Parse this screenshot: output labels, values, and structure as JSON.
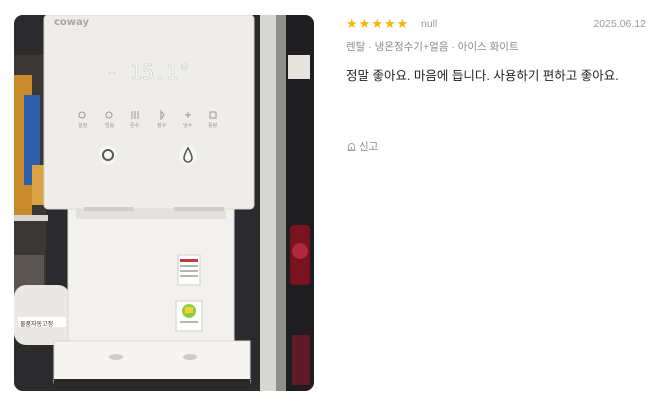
{
  "review": {
    "rating": 5,
    "stars": [
      "★",
      "★",
      "★",
      "★",
      "★"
    ],
    "author": "null",
    "date": "2025.06.12",
    "option": "렌탈 · 냉온정수기+얼음 · 아이스 화이트",
    "text": "정말 좋아요. 마음에 듭니다. 사용하기 편하고 좋아요.",
    "report_label": "신고",
    "report_icon": "siren-icon"
  },
  "photo": {
    "brand": "coway",
    "display_reading": "- 15.1°",
    "button_labels": [
      "설정",
      "얼음",
      "온수",
      "정수",
      "냉수",
      "용량"
    ],
    "colors": {
      "star": "#f5b700",
      "appliance_body": "#eeede9",
      "background_wall": "#2b2b2d"
    }
  }
}
